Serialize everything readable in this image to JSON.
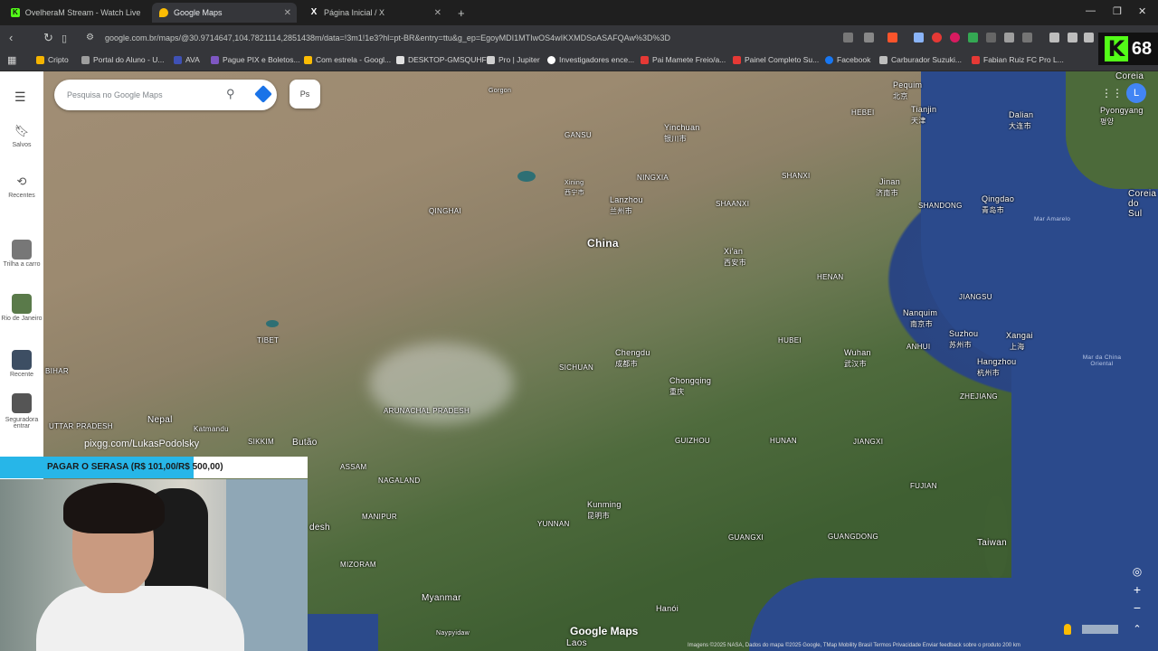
{
  "browser": {
    "tabs": [
      {
        "title": "OvelheraM Stream - Watch Live on K",
        "icon_color": "#53fc18",
        "icon": "K"
      },
      {
        "title": "Google Maps",
        "icon_color": "#fbbc04",
        "icon": "maps-pin"
      },
      {
        "title": "Página Inicial / X",
        "icon_color": "#ffffff",
        "icon": "X"
      }
    ],
    "new_tab": "+",
    "url": "google.com.br/maps/@30.9714647,104.7821114,2851438m/data=!3m1!1e3?hl=pt-BR&entry=ttu&g_ep=EgoyMDI1MTIwOS4wIKXMDSoASAFQAw%3D%3D",
    "bookmarks": [
      {
        "label": "Cripto",
        "color": "#f5b400"
      },
      {
        "label": "Portal do Aluno - U...",
        "color": "#9e9e9e"
      },
      {
        "label": "AVA",
        "color": "#3f51b5"
      },
      {
        "label": "Pague PIX e Boletos...",
        "color": "#7e57c2"
      },
      {
        "label": "Com estrela - Googl...",
        "color": "#fbbc04"
      },
      {
        "label": "DESKTOP-GMSQUHF",
        "color": "#e0e0e0"
      },
      {
        "label": "Pro | Jupiter",
        "color": "#cfcfcf"
      },
      {
        "label": "Investigadores ence...",
        "color": "#ffffff"
      },
      {
        "label": "Pai Mamete Freio/a...",
        "color": "#e53935"
      },
      {
        "label": "Painel Completo Su...",
        "color": "#e53935"
      },
      {
        "label": "Facebook",
        "color": "#1877f2"
      },
      {
        "label": "Carburador Suzuki...",
        "color": "#bdbdbd"
      },
      {
        "label": "Fabian Ruiz FC Pro L...",
        "color": "#e53935"
      }
    ],
    "viewer_count": "68",
    "platform_letter": "K"
  },
  "maps": {
    "search_placeholder": "Pesquisa no Google Maps",
    "chip_label": "Ps",
    "rail": {
      "saved": "Salvos",
      "recent": "Recentes",
      "items": [
        "Trilha a carro",
        "Rio de Janeiro",
        "Recente",
        "Seguradora entrar"
      ]
    },
    "avatar": "L",
    "labels": {
      "countries": [
        "China",
        "Nepal",
        "Butão",
        "Myanmar",
        "Laos",
        "Taiwan",
        "Coreia do Sul"
      ],
      "corea_top": "Coreia",
      "provinces": [
        "GANSU",
        "NINGXIA",
        "QINGHAI",
        "SHANXI",
        "HEBEI",
        "SHANDONG",
        "SHAANXI",
        "HENAN",
        "JIANGSU",
        "ANHUI",
        "HUBEI",
        "SICHUAN",
        "TIBET",
        "ARUNACHAL PRADESH",
        "ASSAM",
        "NAGALAND",
        "MANIPUR",
        "MIZORAM",
        "YUNNAN",
        "GUIZHOU",
        "HUNAN",
        "JIANGXI",
        "FUJIAN",
        "GUANGXI",
        "GUANGDONG",
        "ZHEJIANG",
        "UTTAR PRADESH",
        "SIKKIM"
      ],
      "cities": [
        {
          "name": "Yinchuan",
          "cn": "银川市"
        },
        {
          "name": "Xining",
          "cn": "西宁市"
        },
        {
          "name": "Lanzhou",
          "cn": "兰州市"
        },
        {
          "name": "Xi'an",
          "cn": "西安市"
        },
        {
          "name": "Chengdu",
          "cn": "成都市"
        },
        {
          "name": "Chongqing",
          "cn": "重庆"
        },
        {
          "name": "Wuhan",
          "cn": "武汉市"
        },
        {
          "name": "Nanquim",
          "cn": "南京市"
        },
        {
          "name": "Suzhou",
          "cn": "苏州市"
        },
        {
          "name": "Xangai",
          "cn": "上海"
        },
        {
          "name": "Hangzhou",
          "cn": "杭州市"
        },
        {
          "name": "Kunming",
          "cn": "昆明市"
        },
        {
          "name": "Hanói",
          "cn": ""
        },
        {
          "name": "Jinan",
          "cn": "济南市"
        },
        {
          "name": "Qingdao",
          "cn": "青岛市"
        },
        {
          "name": "Dalian",
          "cn": "大连市"
        },
        {
          "name": "Tianjin",
          "cn": "天津"
        },
        {
          "name": "Pequim",
          "cn": "北京"
        },
        {
          "name": "Pyongyang",
          "cn": "평양"
        },
        {
          "name": "Katmandu",
          "cn": ""
        },
        {
          "name": "Naypyidaw",
          "cn": ""
        },
        {
          "name": "Gorgon",
          "cn": ""
        }
      ],
      "seas": [
        "Mar Amarelo",
        "Mar da China Oriental"
      ],
      "region_partial": [
        "BANGLADESH",
        "BIHAR",
        "desh"
      ]
    },
    "watermark": "Google Maps",
    "attribution": "Imagens ©2025 NASA, Dados do mapa ©2025 Google, TMap Mobility    Brasil    Termos    Privacidade    Enviar feedback sobre o produto    200 km",
    "zoom_in": "+",
    "zoom_out": "−"
  },
  "stream": {
    "pix_text": "pixgg.com/LukasPodolsky",
    "banner_text": "PAGAR O SERASA (R$ 101,00/R$ 500,00)",
    "banner_progress": 0.63
  }
}
